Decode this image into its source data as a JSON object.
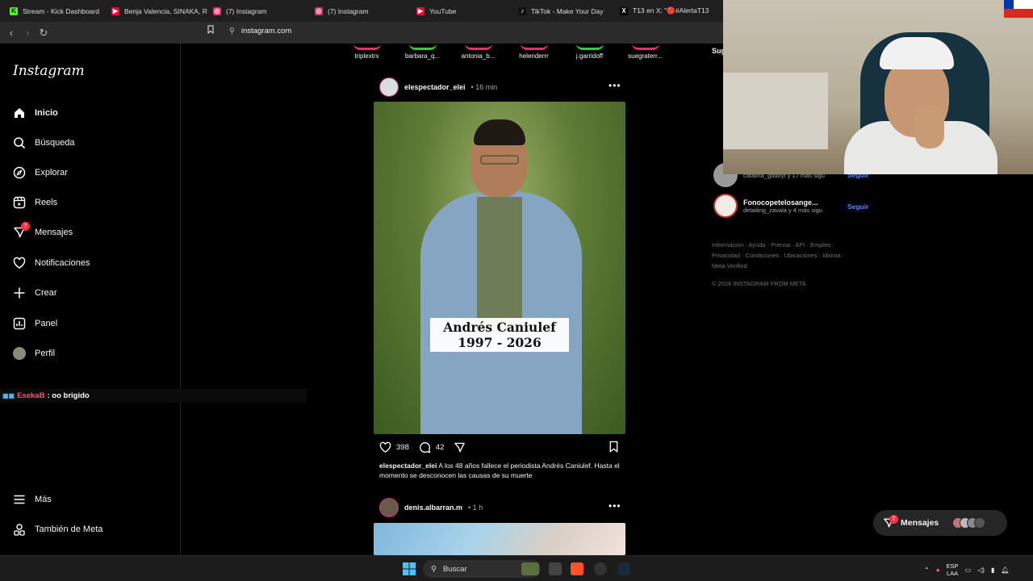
{
  "browser": {
    "tabs": [
      {
        "label": "Stream - Kick Dashboard",
        "icon": "kick-icon",
        "color": "#53fc18"
      },
      {
        "label": "Benja Valencia, SINAKA, R",
        "icon": "youtube-icon",
        "color": "#ff0033"
      },
      {
        "label": "(7) Instagram",
        "icon": "instagram-icon",
        "color": "#e1306c"
      },
      {
        "label": "(7) Instagram",
        "icon": "instagram-icon",
        "color": "#e1306c"
      },
      {
        "label": "YouTube",
        "icon": "youtube-icon",
        "color": "#ff0033"
      },
      {
        "label": "TikTok - Make Your Day",
        "icon": "tiktok-icon",
        "color": "#111111"
      },
      {
        "label": "T13 en X: \"🔴#AlertaT13",
        "icon": "x-icon",
        "color": "#000000"
      }
    ],
    "url": "instagram.com"
  },
  "sidebar": {
    "logo": "Instagram",
    "items": [
      {
        "label": "Inicio",
        "icon": "home-icon"
      },
      {
        "label": "Búsqueda",
        "icon": "search-icon"
      },
      {
        "label": "Explorar",
        "icon": "compass-icon"
      },
      {
        "label": "Reels",
        "icon": "reels-icon"
      },
      {
        "label": "Mensajes",
        "icon": "messenger-icon",
        "badge": "7"
      },
      {
        "label": "Notificaciones",
        "icon": "heart-icon"
      },
      {
        "label": "Crear",
        "icon": "plus-icon"
      },
      {
        "label": "Panel",
        "icon": "dashboard-icon"
      },
      {
        "label": "Perfil",
        "icon": "avatar"
      }
    ],
    "bottom": [
      {
        "label": "Más",
        "icon": "menu-icon"
      },
      {
        "label": "También de Meta",
        "icon": "meta-icon"
      }
    ]
  },
  "chat_overlay": {
    "user": "EsekaB",
    "message": ": oo brigido"
  },
  "stories": [
    "triplextrx",
    "barbara_q...",
    "antonia_b...",
    "helenderrr",
    "j.garridoff",
    "suegraterr..."
  ],
  "post1": {
    "user": "elespectador_elei",
    "time": "• 16 min",
    "image_text_line1": "Andrés Caniulef",
    "image_text_line2": "1997 - 2026",
    "likes": "398",
    "comments": "42",
    "caption_user": "elespectador_elei",
    "caption_text": " A los 48 años fallece el periodista Andrés Caniulef. Hasta el momento se desconocen las causas de su muerte"
  },
  "post2": {
    "user": "denis.albarran.m",
    "time": "• 1 h"
  },
  "right_panel": {
    "suggest_label": "Sug",
    "suggestions": [
      {
        "name": "",
        "sub": "catalina_godoyf y 17 más sigu",
        "follow": "Seguir"
      },
      {
        "name": "Fonocopetelosange...",
        "sub": "detailing_zavala y 4 más sigu",
        "follow": "Seguir"
      }
    ],
    "footer_links": "Información · Ayuda · Prensa · API · Empleo · Privacidad · Condiciones · Ubicaciones · Idioma · Meta Verified",
    "copyright": "© 2026 INSTAGRAM FROM META"
  },
  "messages_pill": {
    "label": "Mensajes",
    "badge": "7"
  },
  "taskbar": {
    "search": "Buscar",
    "lang_line1": "ESP",
    "lang_line2": "LAA"
  }
}
